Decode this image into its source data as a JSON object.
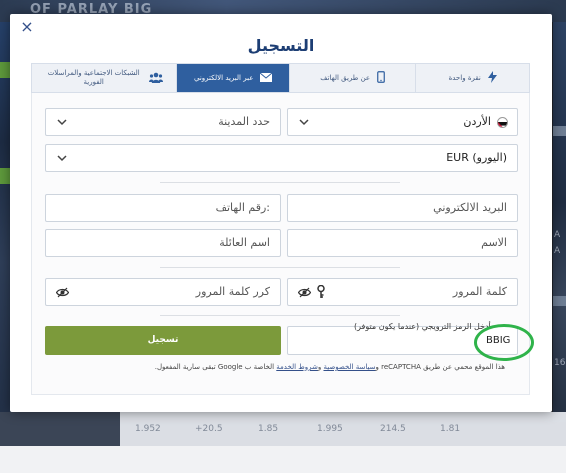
{
  "background": {
    "top_text": "OF PARLAY BIG",
    "right_texts": [
      "A",
      "A",
      "16"
    ],
    "odds": [
      "1.952",
      "+20.5",
      "1.85",
      "1.995",
      "214.5",
      "1.81"
    ]
  },
  "modal": {
    "title": "التسجيل",
    "close_label": "×",
    "tabs": [
      {
        "label": "نقرة واحدة",
        "icon": "lightning-icon",
        "active": false
      },
      {
        "label": "عن طريق الهاتف",
        "icon": "phone-icon",
        "active": false
      },
      {
        "label": "عبر البريد الالكتروني",
        "icon": "envelope-icon",
        "active": true
      },
      {
        "label": "الشبكات الاجتماعية والمراسلات الفورية",
        "icon": "users-icon",
        "active": false
      }
    ],
    "form": {
      "country": "الأردن",
      "city_placeholder": "حدد المدينة",
      "currency": "EUR (اليورو)",
      "email_placeholder": "البريد الالكتروني",
      "phone_placeholder": "رقم الهاتف:",
      "first_name_placeholder": "الاسم",
      "last_name_placeholder": "اسم العائلة",
      "password_placeholder": "كلمة المرور",
      "repeat_password_placeholder": "كرر كلمة المرور",
      "promo_caption": "أدخل الرمز الترويجي (عندما يكون متوفر)",
      "promo_value": "BBIG",
      "submit_label": "تسجيل"
    },
    "legal": {
      "prefix": "هذا الموقع محمي عن طريق reCAPTCHA و",
      "privacy_link": "سياسة الخصوصية",
      "and": " و",
      "terms_link": "شروط الخدمة",
      "suffix": " الخاصة ب Google تبقى سارية المفعول."
    }
  },
  "colors": {
    "title": "#1d3e74",
    "active_tab": "#2f5f9f",
    "submit": "#7c9a3b",
    "promo_highlight": "#2fb34a"
  }
}
